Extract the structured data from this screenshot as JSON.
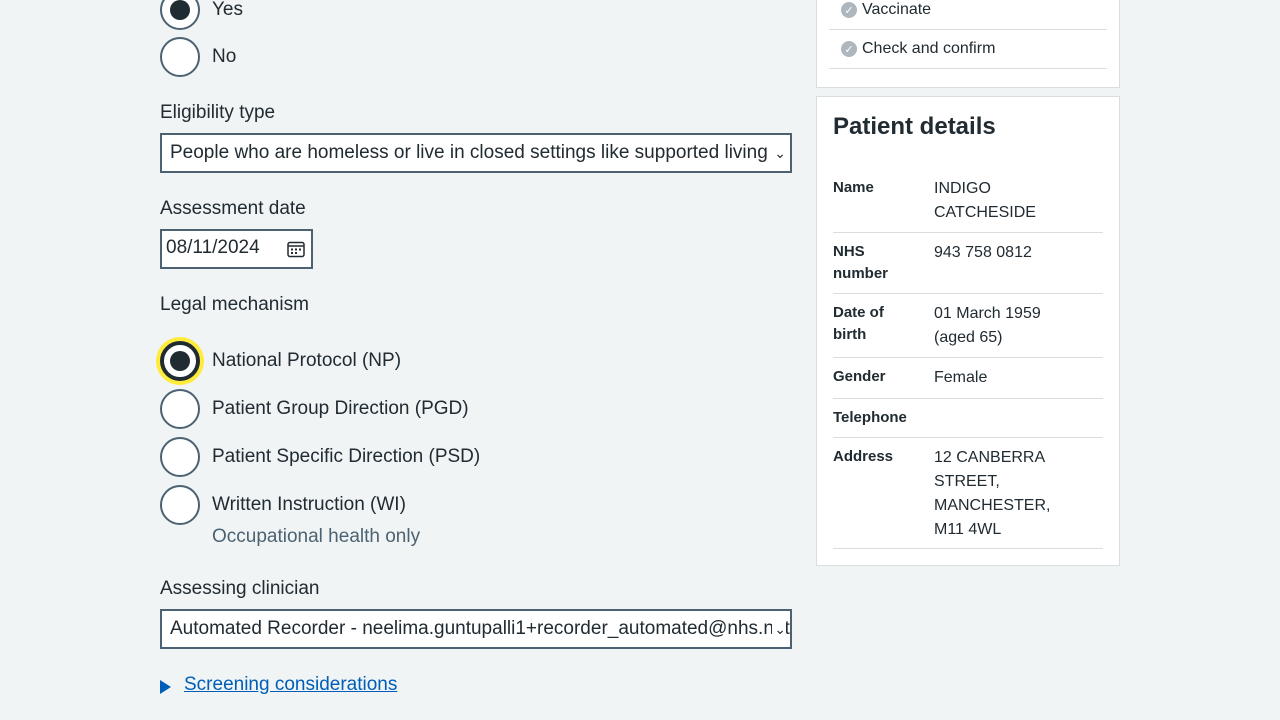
{
  "consent_radios": [
    {
      "label": "Yes",
      "checked": true
    },
    {
      "label": "No",
      "checked": false
    }
  ],
  "eligibility": {
    "label": "Eligibility type",
    "value": "People who are homeless or live in closed settings like supported living"
  },
  "assessment_date": {
    "label": "Assessment date",
    "value": "08/11/2024"
  },
  "legal_mechanism": {
    "label": "Legal mechanism",
    "options": [
      {
        "label": "National Protocol (NP)",
        "checked": true
      },
      {
        "label": "Patient Group Direction (PGD)",
        "checked": false
      },
      {
        "label": "Patient Specific Direction (PSD)",
        "checked": false
      },
      {
        "label": "Written Instruction (WI)",
        "checked": false,
        "hint": "Occupational health only"
      }
    ]
  },
  "assessing_clinician": {
    "label": "Assessing clinician",
    "value": "Automated Recorder - neelima.guntupalli1+recorder_automated@nhs.net"
  },
  "screening": {
    "label": "Screening considerations"
  },
  "steps": [
    {
      "label": "Vaccinate"
    },
    {
      "label": "Check and confirm"
    }
  ],
  "patient": {
    "title": "Patient details",
    "rows": [
      {
        "key": "Name",
        "value": "INDIGO CATCHESIDE"
      },
      {
        "key": "NHS number",
        "value": "943 758 0812"
      },
      {
        "key": "Date of birth",
        "value": "01 March 1959 (aged 65)"
      },
      {
        "key": "Gender",
        "value": "Female"
      },
      {
        "key": "Telephone",
        "value": ""
      },
      {
        "key": "Address",
        "value": "12 CANBERRA STREET, MANCHESTER, M11 4WL"
      }
    ]
  },
  "colors": {
    "link": "#005eb8",
    "focus": "#ffeb3b",
    "border": "#4c6272"
  }
}
